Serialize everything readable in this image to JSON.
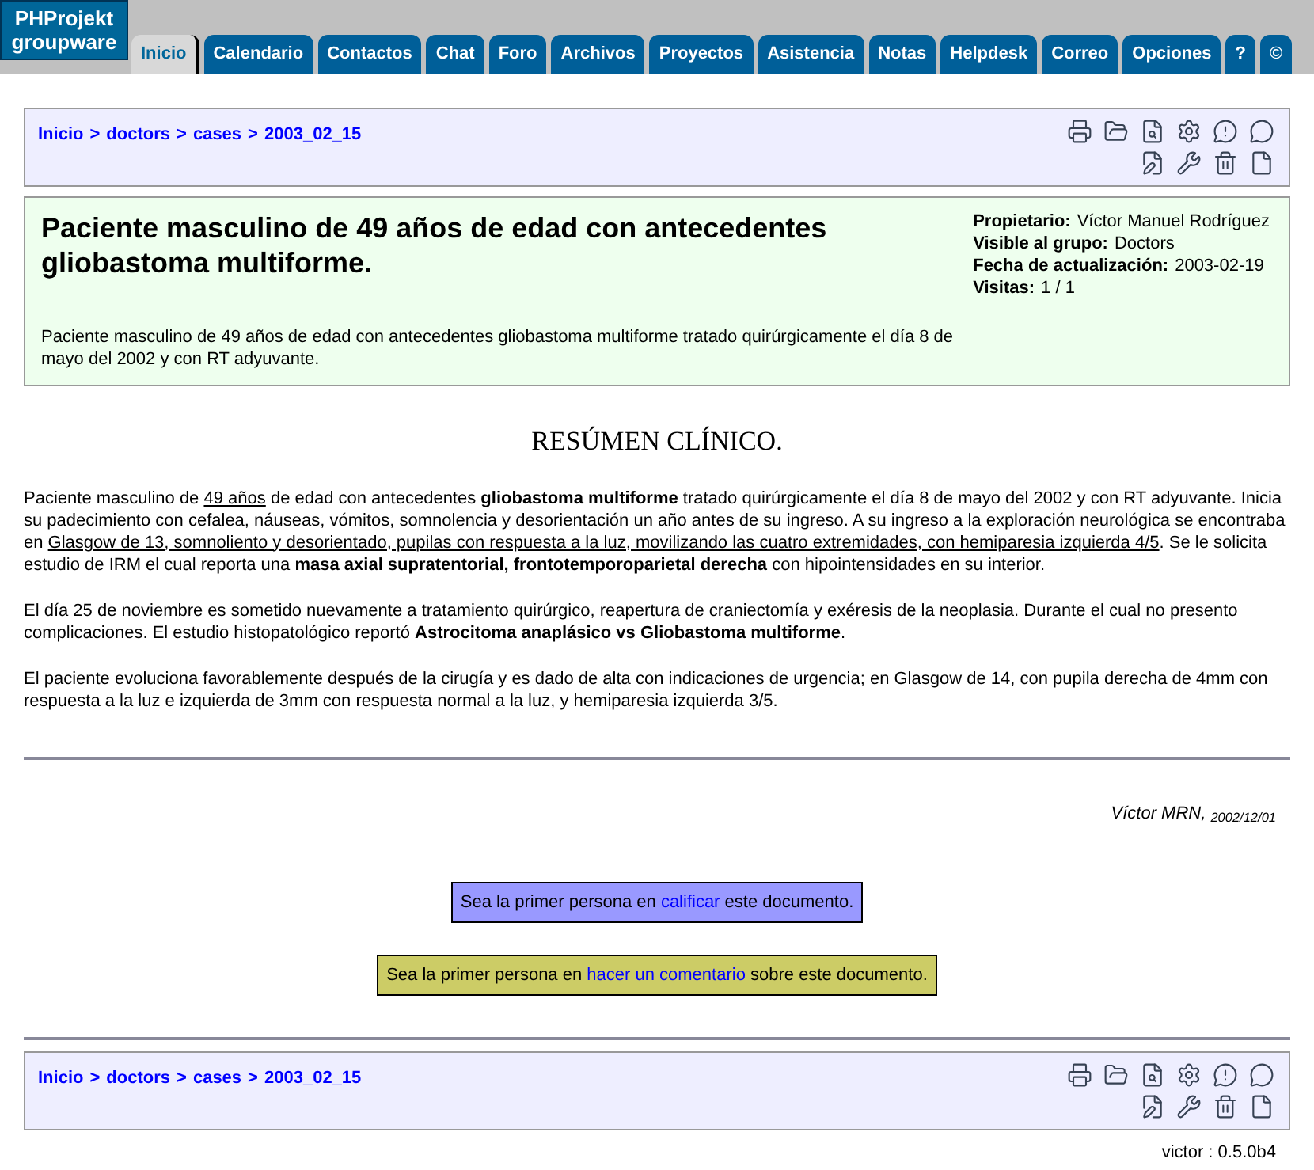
{
  "logo": {
    "lines": [
      "PHProjekt",
      "groupware"
    ]
  },
  "tabs": [
    {
      "label": "Inicio",
      "selected": true
    },
    {
      "label": "Calendario",
      "selected": false
    },
    {
      "label": "Contactos",
      "selected": false
    },
    {
      "label": "Chat",
      "selected": false
    },
    {
      "label": "Foro",
      "selected": false
    },
    {
      "label": "Archivos",
      "selected": false
    },
    {
      "label": "Proyectos",
      "selected": false
    },
    {
      "label": "Asistencia",
      "selected": false
    },
    {
      "label": "Notas",
      "selected": false
    },
    {
      "label": "Helpdesk",
      "selected": false
    },
    {
      "label": "Correo",
      "selected": false
    },
    {
      "label": "Opciones",
      "selected": false
    },
    {
      "label": "?",
      "selected": false
    },
    {
      "label": "©",
      "selected": false
    }
  ],
  "breadcrumb_top": {
    "separator": ">",
    "items": [
      "Inicio",
      "doctors",
      "cases",
      "2003_02_15"
    ]
  },
  "document": {
    "title": "Paciente masculino de 49 años de edad con antecedentes gliobastoma multiforme.",
    "summary": "Paciente masculino de 49 años de edad con antecedentes gliobastoma multiforme tratado quirúrgicamente el día 8 de mayo del 2002 y con RT adyuvante.",
    "meta": [
      {
        "label": "Propietario:",
        "value": "Víctor Manuel Rodríguez"
      },
      {
        "label": "Visible al grupo:",
        "value": "Doctors"
      },
      {
        "label": "Fecha de actualización:",
        "value": "2003-02-19"
      },
      {
        "label": "Visitas:",
        "value": "1 / 1"
      }
    ]
  },
  "section_heading": "RESÚMEN CLÍNICO.",
  "paragraphs": [
    [
      {
        "kind": "plain",
        "text": "Paciente masculino de "
      },
      {
        "kind": "underline",
        "text": "49 años"
      },
      {
        "kind": "plain",
        "text": " de edad con antecedentes "
      },
      {
        "kind": "bold",
        "text": "gliobastoma multiforme"
      },
      {
        "kind": "plain",
        "text": " tratado quirúrgicamente el día 8 de mayo del 2002 y con RT adyuvante. Inicia su padecimiento con cefalea, náuseas, vómitos, somnolencia y desorientación un año antes de su ingreso. A su ingreso a la exploración neurológica se encontraba en "
      },
      {
        "kind": "underline",
        "text": "Glasgow de 13, somnoliento y desorientado, pupilas con respuesta a la luz, movilizando las cuatro extremidades, con hemiparesia izquierda 4/5"
      },
      {
        "kind": "plain",
        "text": ". Se le solicita estudio de IRM el cual reporta una "
      },
      {
        "kind": "bold",
        "text": "masa axial supratentorial, frontotemporoparietal derecha"
      },
      {
        "kind": "plain",
        "text": " con hipointensidades en su interior."
      }
    ],
    [
      {
        "kind": "plain",
        "text": "El día 25 de noviembre es sometido nuevamente a tratamiento quirúrgico, reapertura de craniectomía y exéresis de la neoplasia. Durante el cual no presento complicaciones. El estudio histopatológico reportó "
      },
      {
        "kind": "bold",
        "text": "Astrocitoma anaplásico vs Gliobastoma multiforme"
      },
      {
        "kind": "plain",
        "text": "."
      }
    ],
    [
      {
        "kind": "plain",
        "text": "El paciente evoluciona favorablemente después de la cirugía y es dado de alta con indicaciones de urgencia; en Glasgow de 14, con pupila derecha de 4mm con respuesta a la luz e izquierda de 3mm con respuesta normal a la luz, y hemiparesia izquierda 3/5."
      }
    ]
  ],
  "signature": "Víctor MRN, $_{2002/12/01}$",
  "notices": [
    {
      "color": "#9999ff",
      "before": "Sea la primer persona en ",
      "link": "calificar",
      "after": " este documento."
    },
    {
      "color": "#cccc66",
      "before": "Sea la primer persona en ",
      "link": "hacer un comentario",
      "after": " sobre este documento."
    }
  ],
  "breadcrumb_bottom": {
    "separator": ">",
    "items": [
      "Inicio",
      "doctors",
      "cases",
      "2003_02_15"
    ]
  },
  "footer": "victor : 0.5.0b4"
}
